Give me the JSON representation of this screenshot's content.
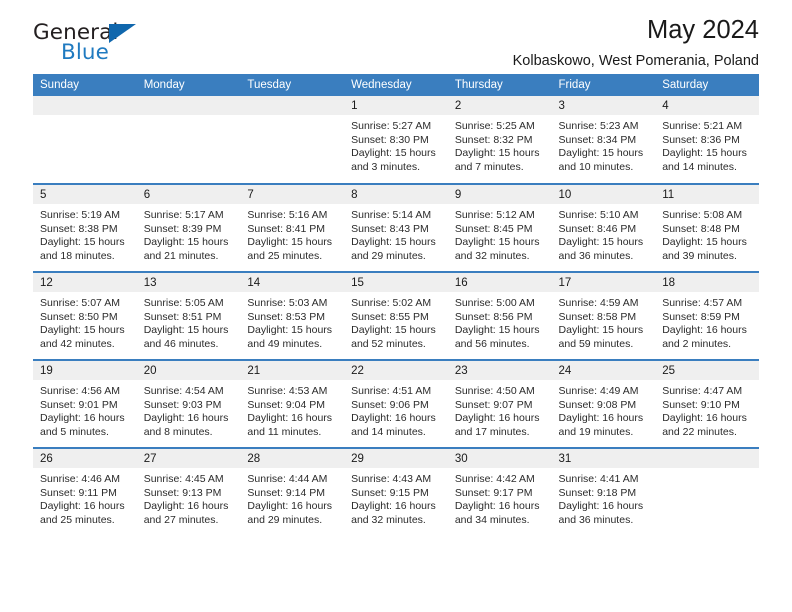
{
  "brand": {
    "name_part1": "General",
    "name_part2": "Blue",
    "logo_icon": "triangle-logo-icon",
    "accent_color": "#1f7ac0"
  },
  "header": {
    "title": "May 2024",
    "subtitle": "Kolbaskowo, West Pomerania, Poland"
  },
  "colors": {
    "header_blue": "#3a7ebf",
    "daynum_band": "#efefef",
    "text": "#1a1a1a"
  },
  "weekdays": [
    "Sunday",
    "Monday",
    "Tuesday",
    "Wednesday",
    "Thursday",
    "Friday",
    "Saturday"
  ],
  "weeks": [
    [
      {
        "day": "",
        "sunrise": "",
        "sunset": "",
        "daylight_line1": "",
        "daylight_line2": ""
      },
      {
        "day": "",
        "sunrise": "",
        "sunset": "",
        "daylight_line1": "",
        "daylight_line2": ""
      },
      {
        "day": "",
        "sunrise": "",
        "sunset": "",
        "daylight_line1": "",
        "daylight_line2": ""
      },
      {
        "day": "1",
        "sunrise": "Sunrise: 5:27 AM",
        "sunset": "Sunset: 8:30 PM",
        "daylight_line1": "Daylight: 15 hours",
        "daylight_line2": "and 3 minutes."
      },
      {
        "day": "2",
        "sunrise": "Sunrise: 5:25 AM",
        "sunset": "Sunset: 8:32 PM",
        "daylight_line1": "Daylight: 15 hours",
        "daylight_line2": "and 7 minutes."
      },
      {
        "day": "3",
        "sunrise": "Sunrise: 5:23 AM",
        "sunset": "Sunset: 8:34 PM",
        "daylight_line1": "Daylight: 15 hours",
        "daylight_line2": "and 10 minutes."
      },
      {
        "day": "4",
        "sunrise": "Sunrise: 5:21 AM",
        "sunset": "Sunset: 8:36 PM",
        "daylight_line1": "Daylight: 15 hours",
        "daylight_line2": "and 14 minutes."
      }
    ],
    [
      {
        "day": "5",
        "sunrise": "Sunrise: 5:19 AM",
        "sunset": "Sunset: 8:38 PM",
        "daylight_line1": "Daylight: 15 hours",
        "daylight_line2": "and 18 minutes."
      },
      {
        "day": "6",
        "sunrise": "Sunrise: 5:17 AM",
        "sunset": "Sunset: 8:39 PM",
        "daylight_line1": "Daylight: 15 hours",
        "daylight_line2": "and 21 minutes."
      },
      {
        "day": "7",
        "sunrise": "Sunrise: 5:16 AM",
        "sunset": "Sunset: 8:41 PM",
        "daylight_line1": "Daylight: 15 hours",
        "daylight_line2": "and 25 minutes."
      },
      {
        "day": "8",
        "sunrise": "Sunrise: 5:14 AM",
        "sunset": "Sunset: 8:43 PM",
        "daylight_line1": "Daylight: 15 hours",
        "daylight_line2": "and 29 minutes."
      },
      {
        "day": "9",
        "sunrise": "Sunrise: 5:12 AM",
        "sunset": "Sunset: 8:45 PM",
        "daylight_line1": "Daylight: 15 hours",
        "daylight_line2": "and 32 minutes."
      },
      {
        "day": "10",
        "sunrise": "Sunrise: 5:10 AM",
        "sunset": "Sunset: 8:46 PM",
        "daylight_line1": "Daylight: 15 hours",
        "daylight_line2": "and 36 minutes."
      },
      {
        "day": "11",
        "sunrise": "Sunrise: 5:08 AM",
        "sunset": "Sunset: 8:48 PM",
        "daylight_line1": "Daylight: 15 hours",
        "daylight_line2": "and 39 minutes."
      }
    ],
    [
      {
        "day": "12",
        "sunrise": "Sunrise: 5:07 AM",
        "sunset": "Sunset: 8:50 PM",
        "daylight_line1": "Daylight: 15 hours",
        "daylight_line2": "and 42 minutes."
      },
      {
        "day": "13",
        "sunrise": "Sunrise: 5:05 AM",
        "sunset": "Sunset: 8:51 PM",
        "daylight_line1": "Daylight: 15 hours",
        "daylight_line2": "and 46 minutes."
      },
      {
        "day": "14",
        "sunrise": "Sunrise: 5:03 AM",
        "sunset": "Sunset: 8:53 PM",
        "daylight_line1": "Daylight: 15 hours",
        "daylight_line2": "and 49 minutes."
      },
      {
        "day": "15",
        "sunrise": "Sunrise: 5:02 AM",
        "sunset": "Sunset: 8:55 PM",
        "daylight_line1": "Daylight: 15 hours",
        "daylight_line2": "and 52 minutes."
      },
      {
        "day": "16",
        "sunrise": "Sunrise: 5:00 AM",
        "sunset": "Sunset: 8:56 PM",
        "daylight_line1": "Daylight: 15 hours",
        "daylight_line2": "and 56 minutes."
      },
      {
        "day": "17",
        "sunrise": "Sunrise: 4:59 AM",
        "sunset": "Sunset: 8:58 PM",
        "daylight_line1": "Daylight: 15 hours",
        "daylight_line2": "and 59 minutes."
      },
      {
        "day": "18",
        "sunrise": "Sunrise: 4:57 AM",
        "sunset": "Sunset: 8:59 PM",
        "daylight_line1": "Daylight: 16 hours",
        "daylight_line2": "and 2 minutes."
      }
    ],
    [
      {
        "day": "19",
        "sunrise": "Sunrise: 4:56 AM",
        "sunset": "Sunset: 9:01 PM",
        "daylight_line1": "Daylight: 16 hours",
        "daylight_line2": "and 5 minutes."
      },
      {
        "day": "20",
        "sunrise": "Sunrise: 4:54 AM",
        "sunset": "Sunset: 9:03 PM",
        "daylight_line1": "Daylight: 16 hours",
        "daylight_line2": "and 8 minutes."
      },
      {
        "day": "21",
        "sunrise": "Sunrise: 4:53 AM",
        "sunset": "Sunset: 9:04 PM",
        "daylight_line1": "Daylight: 16 hours",
        "daylight_line2": "and 11 minutes."
      },
      {
        "day": "22",
        "sunrise": "Sunrise: 4:51 AM",
        "sunset": "Sunset: 9:06 PM",
        "daylight_line1": "Daylight: 16 hours",
        "daylight_line2": "and 14 minutes."
      },
      {
        "day": "23",
        "sunrise": "Sunrise: 4:50 AM",
        "sunset": "Sunset: 9:07 PM",
        "daylight_line1": "Daylight: 16 hours",
        "daylight_line2": "and 17 minutes."
      },
      {
        "day": "24",
        "sunrise": "Sunrise: 4:49 AM",
        "sunset": "Sunset: 9:08 PM",
        "daylight_line1": "Daylight: 16 hours",
        "daylight_line2": "and 19 minutes."
      },
      {
        "day": "25",
        "sunrise": "Sunrise: 4:47 AM",
        "sunset": "Sunset: 9:10 PM",
        "daylight_line1": "Daylight: 16 hours",
        "daylight_line2": "and 22 minutes."
      }
    ],
    [
      {
        "day": "26",
        "sunrise": "Sunrise: 4:46 AM",
        "sunset": "Sunset: 9:11 PM",
        "daylight_line1": "Daylight: 16 hours",
        "daylight_line2": "and 25 minutes."
      },
      {
        "day": "27",
        "sunrise": "Sunrise: 4:45 AM",
        "sunset": "Sunset: 9:13 PM",
        "daylight_line1": "Daylight: 16 hours",
        "daylight_line2": "and 27 minutes."
      },
      {
        "day": "28",
        "sunrise": "Sunrise: 4:44 AM",
        "sunset": "Sunset: 9:14 PM",
        "daylight_line1": "Daylight: 16 hours",
        "daylight_line2": "and 29 minutes."
      },
      {
        "day": "29",
        "sunrise": "Sunrise: 4:43 AM",
        "sunset": "Sunset: 9:15 PM",
        "daylight_line1": "Daylight: 16 hours",
        "daylight_line2": "and 32 minutes."
      },
      {
        "day": "30",
        "sunrise": "Sunrise: 4:42 AM",
        "sunset": "Sunset: 9:17 PM",
        "daylight_line1": "Daylight: 16 hours",
        "daylight_line2": "and 34 minutes."
      },
      {
        "day": "31",
        "sunrise": "Sunrise: 4:41 AM",
        "sunset": "Sunset: 9:18 PM",
        "daylight_line1": "Daylight: 16 hours",
        "daylight_line2": "and 36 minutes."
      },
      {
        "day": "",
        "sunrise": "",
        "sunset": "",
        "daylight_line1": "",
        "daylight_line2": ""
      }
    ]
  ]
}
